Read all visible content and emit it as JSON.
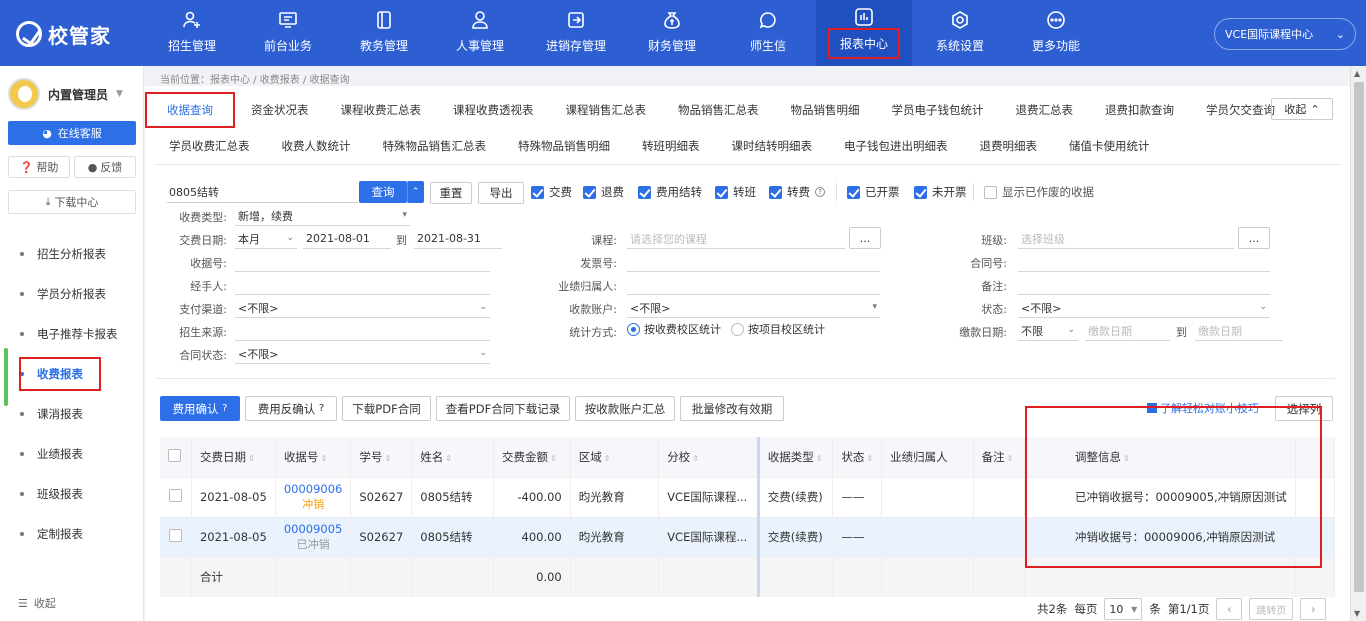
{
  "app": {
    "logo_text": "校管家",
    "org_name": "VCE国际课程中心"
  },
  "nav": [
    {
      "label": "招生管理",
      "icon": "add-user-icon"
    },
    {
      "label": "前台业务",
      "icon": "monitor-icon"
    },
    {
      "label": "教务管理",
      "icon": "book-icon"
    },
    {
      "label": "人事管理",
      "icon": "person-icon"
    },
    {
      "label": "进销存管理",
      "icon": "exchange-icon"
    },
    {
      "label": "财务管理",
      "icon": "money-bag-icon"
    },
    {
      "label": "师生信",
      "icon": "chat-icon"
    },
    {
      "label": "报表中心",
      "icon": "bar-chart-icon"
    },
    {
      "label": "系统设置",
      "icon": "gear-icon"
    },
    {
      "label": "更多功能",
      "icon": "more-icon"
    }
  ],
  "sidebar": {
    "user_name": "内置管理员",
    "online_service": "在线客服",
    "help": "帮助",
    "feedback": "反馈",
    "download_center": "下载中心",
    "items": [
      {
        "label": "招生分析报表"
      },
      {
        "label": "学员分析报表"
      },
      {
        "label": "电子推荐卡报表"
      },
      {
        "label": "收费报表"
      },
      {
        "label": "课消报表"
      },
      {
        "label": "业绩报表"
      },
      {
        "label": "班级报表"
      },
      {
        "label": "定制报表"
      }
    ],
    "collapse": "收起"
  },
  "breadcrumb": "当前位置：报表中心 / 收费报表 / 收据查询",
  "tabs_row1": [
    "收据查询",
    "资金状况表",
    "课程收费汇总表",
    "课程收费透视表",
    "课程销售汇总表",
    "物品销售汇总表",
    "物品销售明细",
    "学员电子钱包统计",
    "退费汇总表",
    "退费扣款查询",
    "学员欠交查询"
  ],
  "tabs_row2": [
    "学员收费汇总表",
    "收费人数统计",
    "特殊物品销售汇总表",
    "特殊物品销售明细",
    "转班明细表",
    "课时结转明细表",
    "电子钱包进出明细表",
    "退费明细表",
    "储值卡使用统计"
  ],
  "collapse_btn": "收起",
  "search": {
    "keyword": "0805结转",
    "query_btn": "查询",
    "reset_btn": "重置",
    "export_btn": "导出",
    "checks": [
      {
        "label": "交费",
        "on": true
      },
      {
        "label": "退费",
        "on": true
      },
      {
        "label": "费用结转",
        "on": true
      },
      {
        "label": "转班",
        "on": true
      },
      {
        "label": "转费",
        "on": true
      },
      {
        "label": "已开票",
        "on": true
      },
      {
        "label": "未开票",
        "on": true
      },
      {
        "label": "显示已作废的收据",
        "on": false
      }
    ]
  },
  "filters": {
    "fee_type_label": "收费类型:",
    "fee_type_value": "新增，续费",
    "date_label": "交费日期:",
    "date_range": "本月",
    "date_from": "2021-08-01",
    "date_to_sep": "到",
    "date_to": "2021-08-31",
    "course_label": "课程:",
    "course_ph": "请选择您的课程",
    "class_label": "班级:",
    "class_ph": "选择班级",
    "receipt_label": "收据号:",
    "invoice_label": "发票号:",
    "contract_label": "合同号:",
    "handler_label": "经手人:",
    "owner_label": "业绩归属人:",
    "remark_label": "备注:",
    "pay_channel_label": "支付渠道:",
    "pay_channel_value": "<不限>",
    "account_label": "收款账户:",
    "account_value": "<不限>",
    "status_label": "状态:",
    "status_value": "<不限>",
    "source_label": "招生来源:",
    "stat_label": "统计方式:",
    "stat_opt1": "按收费校区统计",
    "stat_opt2": "按项目校区统计",
    "pay_date_label": "缴款日期:",
    "pay_date_value": "不限",
    "pay_date_ph1": "缴款日期",
    "pay_date_sep": "到",
    "pay_date_ph2": "缴款日期",
    "contract_status_label": "合同状态:",
    "contract_status_value": "<不限>"
  },
  "actions": {
    "confirm": "费用确认",
    "unconfirm": "费用反确认",
    "download_pdf": "下载PDF合同",
    "pdf_log": "查看PDF合同下载记录",
    "by_account": "按收款账户汇总",
    "batch_edit": "批量修改有效期",
    "tip": "了解轻松对账小技巧",
    "choose_cols": "选择列"
  },
  "table": {
    "headers": [
      "交费日期",
      "收据号",
      "学号",
      "姓名",
      "交费金额",
      "区域",
      "分校",
      "收据类型",
      "状态",
      "业绩归属人",
      "备注",
      "调整信息"
    ],
    "rows": [
      {
        "date": "2021-08-05",
        "receipt": "00009006",
        "tag": "冲销",
        "student_id": "S02627",
        "name": "0805结转",
        "amount": "-400.00",
        "region": "昀光教育",
        "branch": "VCE国际课程...",
        "type": "交费(续费)",
        "status": "——",
        "owner": "",
        "remark": "",
        "adjust": "已冲销收据号：00009005,冲销原因测试"
      },
      {
        "date": "2021-08-05",
        "receipt": "00009005",
        "tag": "已冲销",
        "student_id": "S02627",
        "name": "0805结转",
        "amount": "400.00",
        "region": "昀光教育",
        "branch": "VCE国际课程...",
        "type": "交费(续费)",
        "status": "——",
        "owner": "",
        "remark": "",
        "adjust": "冲销收据号：00009006,冲销原因测试"
      }
    ],
    "sum_label": "合计",
    "sum_amount": "0.00"
  },
  "pager": {
    "total": "共2条",
    "per_page_label": "每页",
    "per_page": "10",
    "unit": "条",
    "page_info": "第1/1页",
    "jump": "跳转页"
  }
}
